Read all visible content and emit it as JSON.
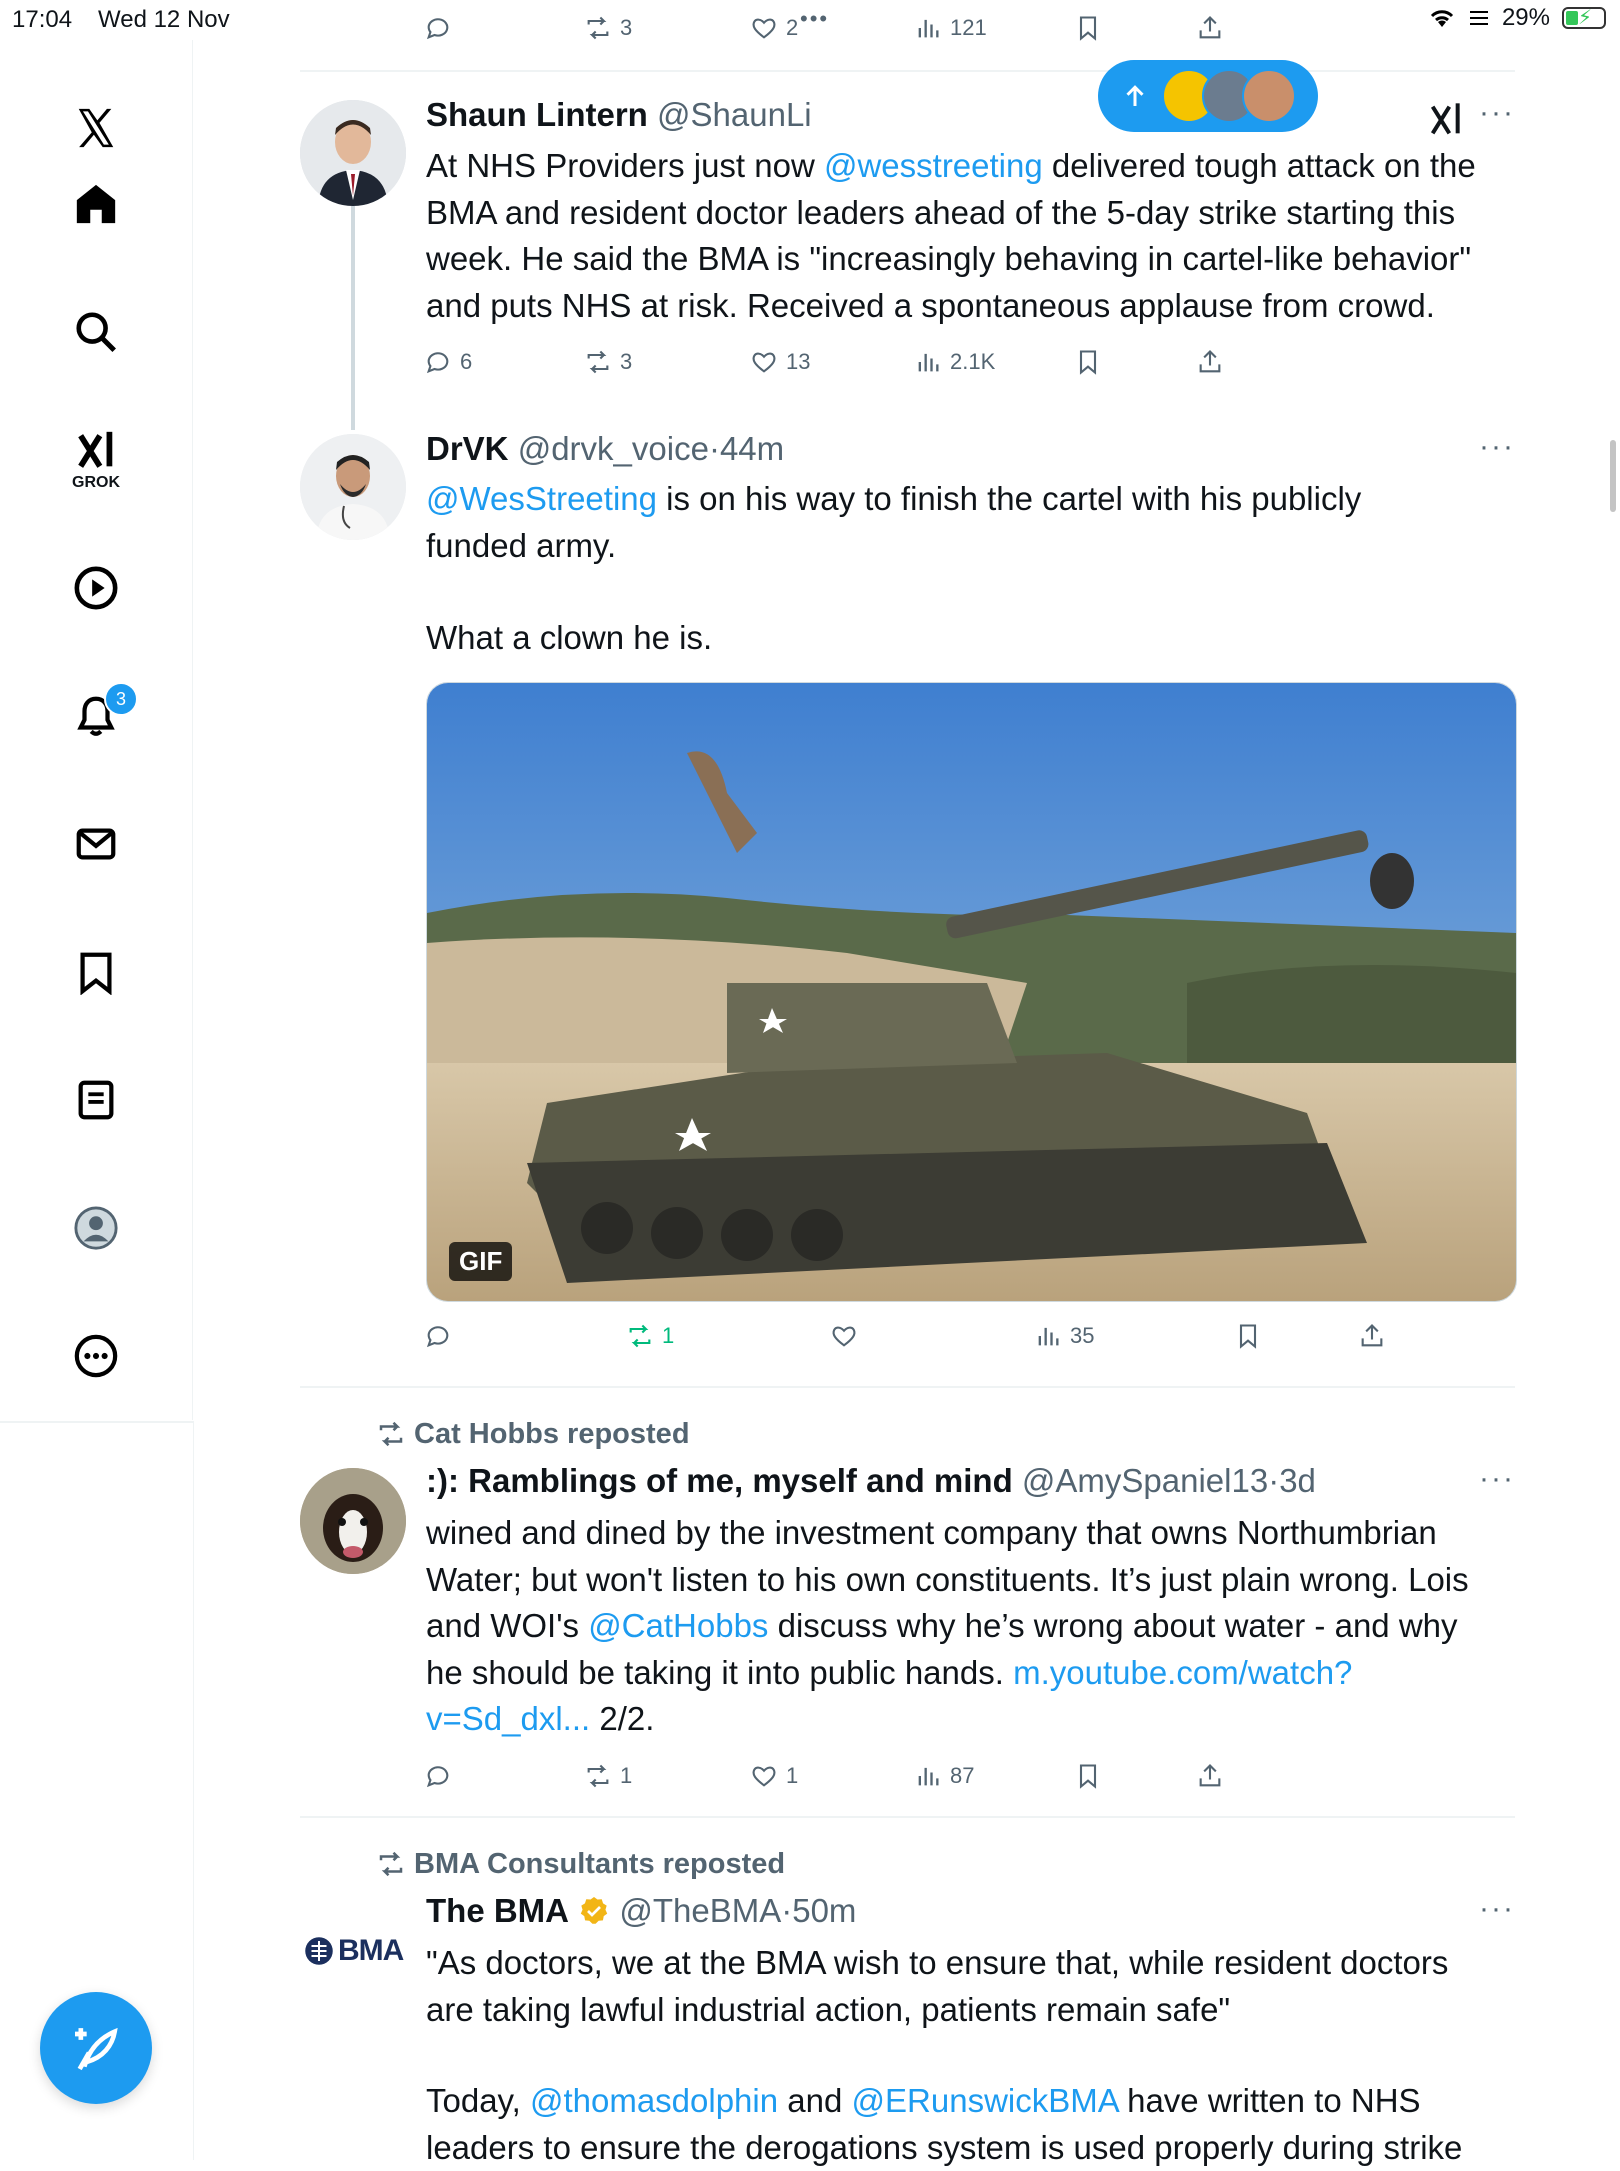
{
  "status_bar": {
    "time": "17:04",
    "date": "Wed 12 Nov",
    "battery": "29%"
  },
  "sidebar": {
    "items": [
      {
        "name": "home"
      },
      {
        "name": "explore"
      },
      {
        "name": "grok",
        "label": "GROK"
      },
      {
        "name": "video"
      },
      {
        "name": "notifications",
        "badge": "3"
      },
      {
        "name": "messages"
      },
      {
        "name": "bookmarks"
      },
      {
        "name": "lists"
      },
      {
        "name": "profile"
      },
      {
        "name": "more"
      }
    ]
  },
  "top_actions": {
    "replies": "",
    "reposts": "3",
    "likes": "2",
    "views": "121"
  },
  "tweets": [
    {
      "name": "Shaun Lintern",
      "handle": "@ShaunLi",
      "body_parts": [
        "At NHS Providers just now ",
        "@wesstreeting",
        " delivered tough attack on the BMA and resident doctor leaders ahead of the 5-day strike starting this week. He said the BMA is \"increasingly behaving in cartel-like behavior\" and puts NHS at risk. Received a spontaneous applause from crowd."
      ],
      "replies": "6",
      "reposts": "3",
      "likes": "13",
      "views": "2.1K"
    },
    {
      "name": "DrVK",
      "handle": "@drvk_voice",
      "time": "44m",
      "body_parts": [
        "@WesStreeting",
        " is on his way to finish the cartel with his publicly funded army.",
        "What a clown he is."
      ],
      "media_badge": "GIF",
      "replies": "",
      "reposts": "1",
      "likes": "",
      "views": "35"
    },
    {
      "repost_label": "Cat Hobbs reposted",
      "name": ":): Ramblings of me, myself and mind",
      "handle": "@AmySpaniel13",
      "time": "3d",
      "body_parts": [
        "wined and dined by the investment company that owns Northumbrian Water; but won't listen to his own constituents. It’s just plain wrong. Lois and WOI's ",
        "@CatHobbs",
        " discuss why he’s wrong about water - and why he should be taking it into public hands. ",
        "m.youtube.com/watch?v=Sd_dxl...",
        " 2/2."
      ],
      "replies": "",
      "reposts": "1",
      "likes": "1",
      "views": "87"
    },
    {
      "repost_label": "BMA Consultants reposted",
      "name": "The BMA",
      "handle": "@TheBMA",
      "time": "50m",
      "logo_text": "BMA",
      "body_parts": [
        "\"As doctors, we at the BMA wish to ensure that, while resident doctors are taking lawful industrial action, patients remain safe\"",
        "Today, ",
        "@thomasdolphin",
        " and ",
        "@ERunswickBMA",
        " have written to NHS leaders to ensure the derogations system is used properly during strike"
      ]
    }
  ],
  "colors": {
    "accent": "#1d9bf0",
    "text": "#0f1419",
    "muted": "#536471",
    "repost_green": "#00ba7c"
  }
}
